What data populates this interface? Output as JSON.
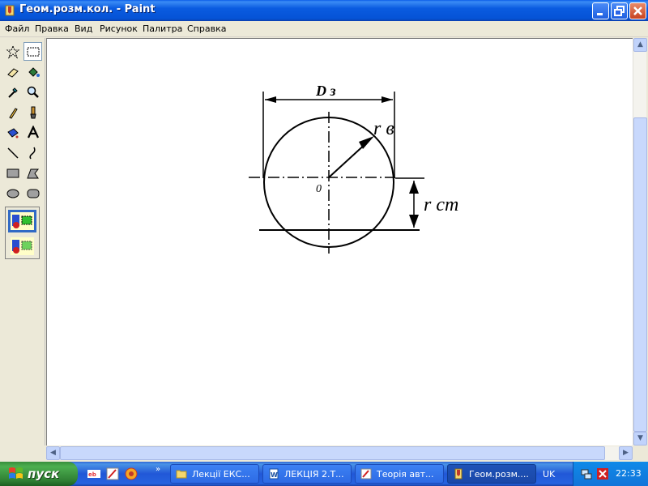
{
  "window": {
    "title": "Геом.розм.кол.  - Paint"
  },
  "menubar": {
    "items": [
      "Файл",
      "Правка",
      "Вид",
      "Рисунок",
      "Палитра",
      "Справка"
    ]
  },
  "toolbox": {
    "tools": [
      "free-select",
      "rect-select",
      "eraser",
      "fill",
      "color-picker",
      "magnifier",
      "pencil",
      "brush",
      "airbrush",
      "text",
      "line",
      "curve",
      "rectangle",
      "polygon",
      "ellipse",
      "rounded-rectangle"
    ],
    "selected_tool": "rect-select"
  },
  "drawing": {
    "label_diameter": "D з",
    "label_radius_b": "r в",
    "label_center": "0",
    "label_radius_ct": "r ст"
  },
  "taskbar": {
    "start_label": "пуск",
    "tasks": [
      "Лекції ЕКС...",
      "ЛЕКЦІЯ 2.Т...",
      "Теорія авт...",
      "Геом.розм...."
    ],
    "language": "UK",
    "clock": "22:33"
  },
  "colors": {
    "title_bar": "#0553d6",
    "taskbar": "#2157d7",
    "start_button": "#3c8f3c",
    "canvas": "#ffffff"
  }
}
